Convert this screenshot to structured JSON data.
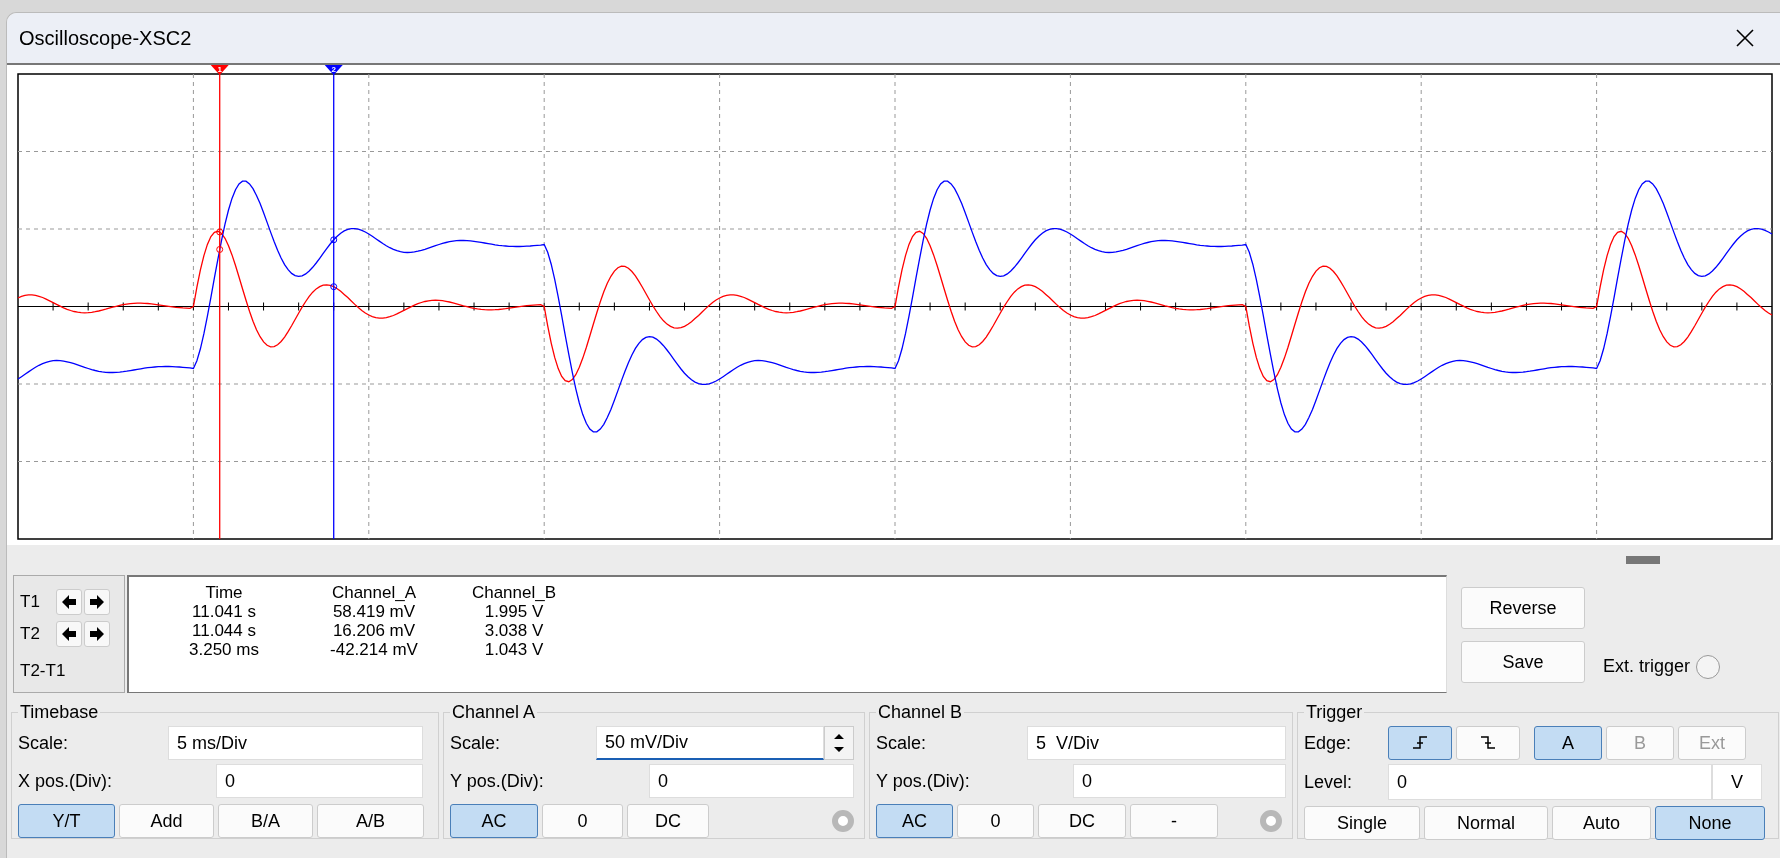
{
  "window": {
    "title": "Oscilloscope-XSC2"
  },
  "scope": {
    "cursors": [
      {
        "label": "1",
        "level": 0.115
      },
      {
        "label": "2",
        "level": 0.18
      }
    ]
  },
  "cursor_controls": [
    {
      "label": "T1",
      "buttons": [
        {
          "kind": "left"
        },
        {
          "kind": "right"
        }
      ]
    },
    {
      "label": "T2",
      "buttons": [
        {
          "kind": "left"
        },
        {
          "kind": "right"
        }
      ]
    },
    {
      "label": "T2-T1"
    }
  ],
  "readout": {
    "columns": [
      "Time",
      "Channel_A",
      "Channel_B"
    ],
    "rows": [
      [
        "11.041 s",
        "58.419 mV",
        "1.995 V"
      ],
      [
        "11.044 s",
        "16.206 mV",
        "3.038 V"
      ],
      [
        "3.250 ms",
        "-42.214 mV",
        "1.043 V"
      ]
    ]
  },
  "buttons": [
    "Reverse",
    "Save"
  ],
  "ext_trigger": {
    "label": "Ext. trigger",
    "checked": false
  },
  "timebase": {
    "title": "Timebase",
    "fields": [
      {
        "label": "Scale:",
        "value": "5 ms/Div",
        "focused": false,
        "spinner": false
      },
      {
        "label": "X pos.(Div):",
        "value": "0",
        "focused": false,
        "spinner": false
      }
    ],
    "modes": [
      {
        "label": "Y/T",
        "selected": true
      },
      {
        "label": "Add",
        "selected": false
      },
      {
        "label": "B/A",
        "selected": false
      },
      {
        "label": "A/B",
        "selected": false
      }
    ]
  },
  "channel_a": {
    "title": "Channel A",
    "fields": [
      {
        "label": "Scale:",
        "value": "50 mV/Div",
        "focused": true,
        "spinner": true
      },
      {
        "label": "Y pos.(Div):",
        "value": "0",
        "focused": false,
        "spinner": false
      }
    ],
    "coupling": [
      {
        "label": "AC",
        "selected": true
      },
      {
        "label": "0",
        "selected": false
      },
      {
        "label": "DC",
        "selected": false
      }
    ]
  },
  "channel_b": {
    "title": "Channel B",
    "fields": [
      {
        "label": "Scale:",
        "value": "5  V/Div",
        "focused": false,
        "spinner": false
      },
      {
        "label": "Y pos.(Div):",
        "value": "0",
        "focused": false,
        "spinner": false
      }
    ],
    "coupling": [
      {
        "label": "AC",
        "selected": true
      },
      {
        "label": "0",
        "selected": false
      },
      {
        "label": "DC",
        "selected": false
      },
      {
        "label": "-",
        "selected": false
      }
    ]
  },
  "trigger": {
    "title": "Trigger",
    "edge_label": "Edge:",
    "edges": [
      {
        "kind": "rising",
        "selected": true
      },
      {
        "kind": "falling",
        "selected": false
      }
    ],
    "sources": [
      {
        "label": "A",
        "selected": true,
        "disabled": false
      },
      {
        "label": "B",
        "selected": false,
        "disabled": true
      },
      {
        "label": "Ext",
        "selected": false,
        "disabled": true
      }
    ],
    "level_label": "Level:",
    "level_value": "0",
    "level_unit": "V",
    "modes": [
      {
        "label": "Single",
        "selected": false
      },
      {
        "label": "Normal",
        "selected": false
      },
      {
        "label": "Auto",
        "selected": false
      },
      {
        "label": "None",
        "selected": true
      }
    ]
  }
}
